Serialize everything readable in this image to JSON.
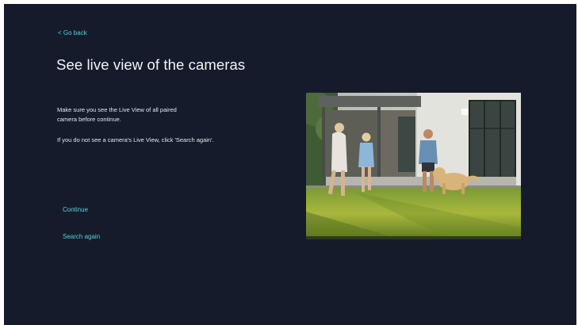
{
  "nav": {
    "go_back_label": "< Go back"
  },
  "header": {
    "title": "See live view of the cameras"
  },
  "main": {
    "instruction": "Make sure you see the Live View of all paired camera before continue.",
    "hint": "If you do not see a camera's Live View, click 'Search again'."
  },
  "actions": {
    "continue_label": "Continue",
    "search_again_label": "Search again"
  },
  "colors": {
    "background": "#161b2c",
    "accent": "#52d3d8",
    "text": "#f2f4f7"
  },
  "camera_preview": {
    "icon": "camera-live-view-image"
  }
}
